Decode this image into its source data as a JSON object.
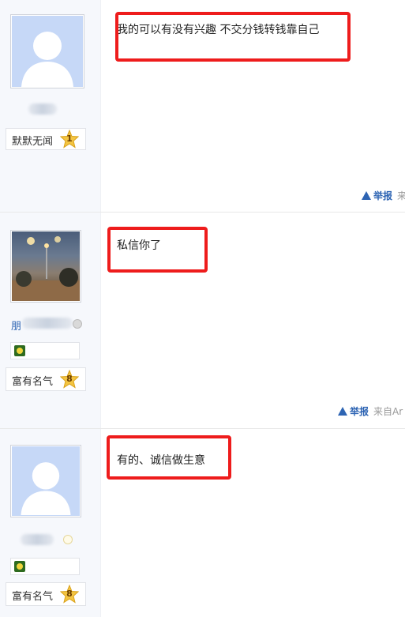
{
  "posts": [
    {
      "username": "",
      "level_title": "默默无闻",
      "level": "1",
      "content": "我的可以有没有兴趣 不交分钱转钱靠自己",
      "report_label": "举报",
      "source_label": "来"
    },
    {
      "username": "朋",
      "level_title": "富有名气",
      "level": "8",
      "content": "私信你了",
      "report_label": "举报",
      "source_label": "来自Ar"
    },
    {
      "username": "",
      "level_title": "富有名气",
      "level": "8",
      "content": "有的、诚信做生意",
      "report_label": "",
      "source_label": ""
    }
  ],
  "colors": {
    "accent": "#2d64b3",
    "highlight": "#ee1c1c",
    "sidebar_bg": "#f6f8fc"
  }
}
